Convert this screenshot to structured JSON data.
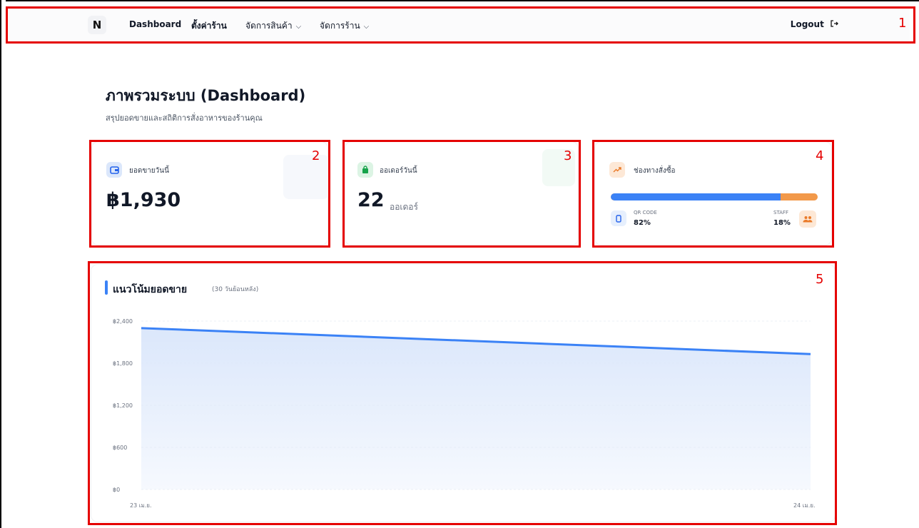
{
  "nav": {
    "logo": "N",
    "links": [
      "Dashboard",
      "ตั้งค่าร้าน",
      "จัดการสินค้า",
      "จัดการร้าน"
    ],
    "logout": "Logout"
  },
  "header": {
    "title": "ภาพรวมระบบ (Dashboard)",
    "subtitle": "สรุปยอดขายและสถิติการสั่งอาหารของร้านคุณ"
  },
  "cards": {
    "sales": {
      "label": "ยอดขายวันนี้",
      "value": "฿1,930"
    },
    "orders": {
      "label": "ออเดอร์วันนี้",
      "value": "22",
      "unit": "ออเดอร์"
    },
    "channels": {
      "label": "ช่องทางสั่งซื้อ",
      "qr_label": "QR CODE",
      "qr_value": "82%",
      "staff_label": "STAFF",
      "staff_value": "18%",
      "qr_fraction": 0.82
    }
  },
  "annotations": [
    "1",
    "2",
    "3",
    "4",
    "5"
  ],
  "chart": {
    "title": "แนวโน้มยอดขาย",
    "subtitle": "(30 วันย้อนหลัง)"
  },
  "chart_data": {
    "type": "area",
    "x": [
      "23 เม.ย.",
      "24 เม.ย."
    ],
    "values": [
      2300,
      1930
    ],
    "y_ticks": [
      "฿2,400",
      "฿1,800",
      "฿1,200",
      "฿600",
      "฿0"
    ],
    "ylim": [
      0,
      2400
    ],
    "grid": true,
    "colors": {
      "line": "#3b82f6",
      "fill": "#dbe7fb"
    }
  }
}
